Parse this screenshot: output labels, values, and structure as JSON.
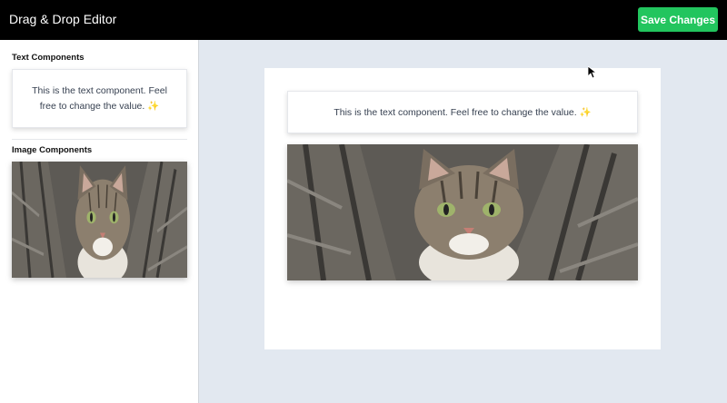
{
  "header": {
    "title": "Drag & Drop Editor",
    "save_label": "Save Changes"
  },
  "sidebar": {
    "text_section_title": "Text Components",
    "text_component": "This is the text component. Feel free to change the value. ✨",
    "image_section_title": "Image Components",
    "image_component": {
      "icon": "cat-photo"
    }
  },
  "canvas": {
    "text_component": "This is the text component. Feel free to change the value. ✨",
    "image_component": {
      "icon": "cat-photo"
    }
  },
  "colors": {
    "header_bg": "#000000",
    "save_button": "#22c55e",
    "canvas_bg": "#e2e8f0"
  }
}
